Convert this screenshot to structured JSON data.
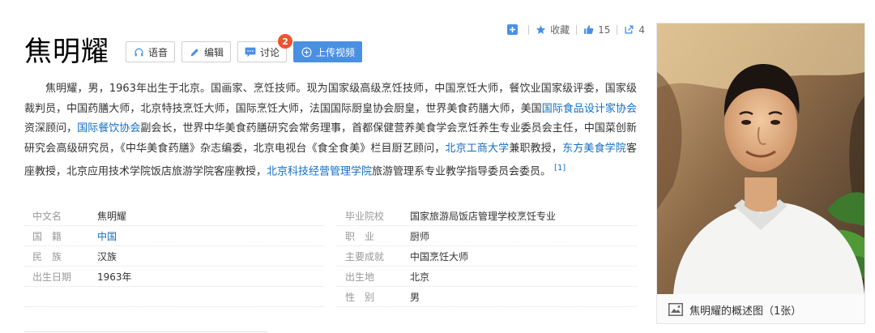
{
  "header": {
    "title": "焦明耀",
    "buttons": {
      "voice": "语音",
      "edit": "编辑",
      "discuss": "讨论",
      "discuss_badge": "2",
      "upload_video": "上传视频"
    }
  },
  "toolbar": {
    "favorite": "收藏",
    "like_count": "15",
    "share_count": "4"
  },
  "summary": {
    "p1": "焦明耀，男，1963年出生于北京。国画家、烹饪技师。现为国家级高级烹饪技师，中国烹饪大师，餐饮业国家级评委，国家级裁判员，中国药膳大师，北京特技烹饪大师，国际烹饪大师，法国国际厨皇协会厨皇，世界美食药膳大师，美国",
    "link1": "国际食品设计家协会",
    "p2": "资深顾问，",
    "link2": "国际餐饮协会",
    "p3": "副会长，世界中华美食药膳研究会常务理事，首都保健营养美食学会烹饪养生专业委员会主任，中国菜创新研究会高级研究员，《中华美食药膳》杂志编委，北京电视台《食全食美》栏目厨艺顾问，",
    "link3": "北京工商大学",
    "p4": "兼职教授，",
    "link4": "东方美食学院",
    "p5": "客座教授，北京应用技术学院饭店旅游学院客座教授，",
    "link5": "北京科技经营管理学院",
    "p6": "旅游管理系专业教学指导委员会委员。",
    "ref": "[1]"
  },
  "basic_info": {
    "left": [
      {
        "key": "中文名",
        "value": "焦明耀"
      },
      {
        "key": "国籍",
        "value": "中国"
      },
      {
        "key": "民族",
        "value": "汉族"
      },
      {
        "key": "出生日期",
        "value": "1963年"
      }
    ],
    "right": [
      {
        "key": "毕业院校",
        "value": "国家旅游局饭店管理学校烹饪专业"
      },
      {
        "key": "职业",
        "value": "厨师"
      },
      {
        "key": "主要成就",
        "value": "中国烹饪大师"
      },
      {
        "key": "出生地",
        "value": "北京"
      },
      {
        "key": "性别",
        "value": "男"
      }
    ]
  },
  "photo": {
    "caption": "焦明耀的概述图（1张）"
  },
  "colors": {
    "link": "#136ec2",
    "primary": "#4a90e2",
    "badge": "#f0522e"
  }
}
